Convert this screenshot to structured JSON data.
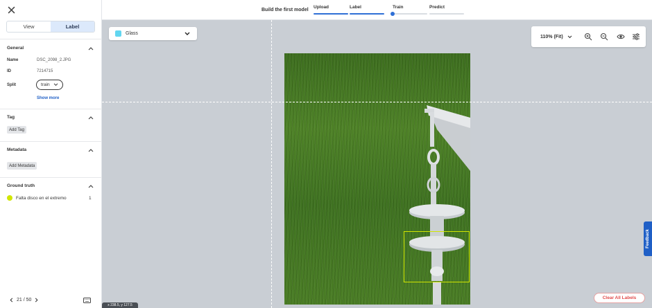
{
  "sidebar": {
    "tabs": [
      {
        "label": "View"
      },
      {
        "label": "Label"
      }
    ],
    "general": {
      "title": "General",
      "name_label": "Name",
      "name_value": "DSC_2098_2.JPG",
      "id_label": "ID",
      "id_value": "7214715",
      "split_label": "Split",
      "split_value": "train",
      "show_more": "Show more"
    },
    "tag": {
      "title": "Tag",
      "add": "Add Tag"
    },
    "metadata": {
      "title": "Metadata",
      "add": "Add Metadata"
    },
    "ground_truth": {
      "title": "Ground truth",
      "item_name": "Falta disco en el extremo",
      "item_count": "1",
      "item_color": "#d1e600"
    },
    "pager": {
      "text": "21 / 50"
    }
  },
  "topbar": {
    "title": "Build the first model",
    "steps": [
      {
        "label": "Upload"
      },
      {
        "label": "Label"
      },
      {
        "label": "Train"
      },
      {
        "label": "Predict"
      }
    ]
  },
  "canvas": {
    "class_selector": {
      "value": "Glass",
      "color": "#62d6f0"
    },
    "zoom": {
      "label": "110% (Fit)"
    },
    "clear_button": "Clear All Labels",
    "feedback": "Feedback",
    "coords": "x 238.5, y 127.5"
  }
}
